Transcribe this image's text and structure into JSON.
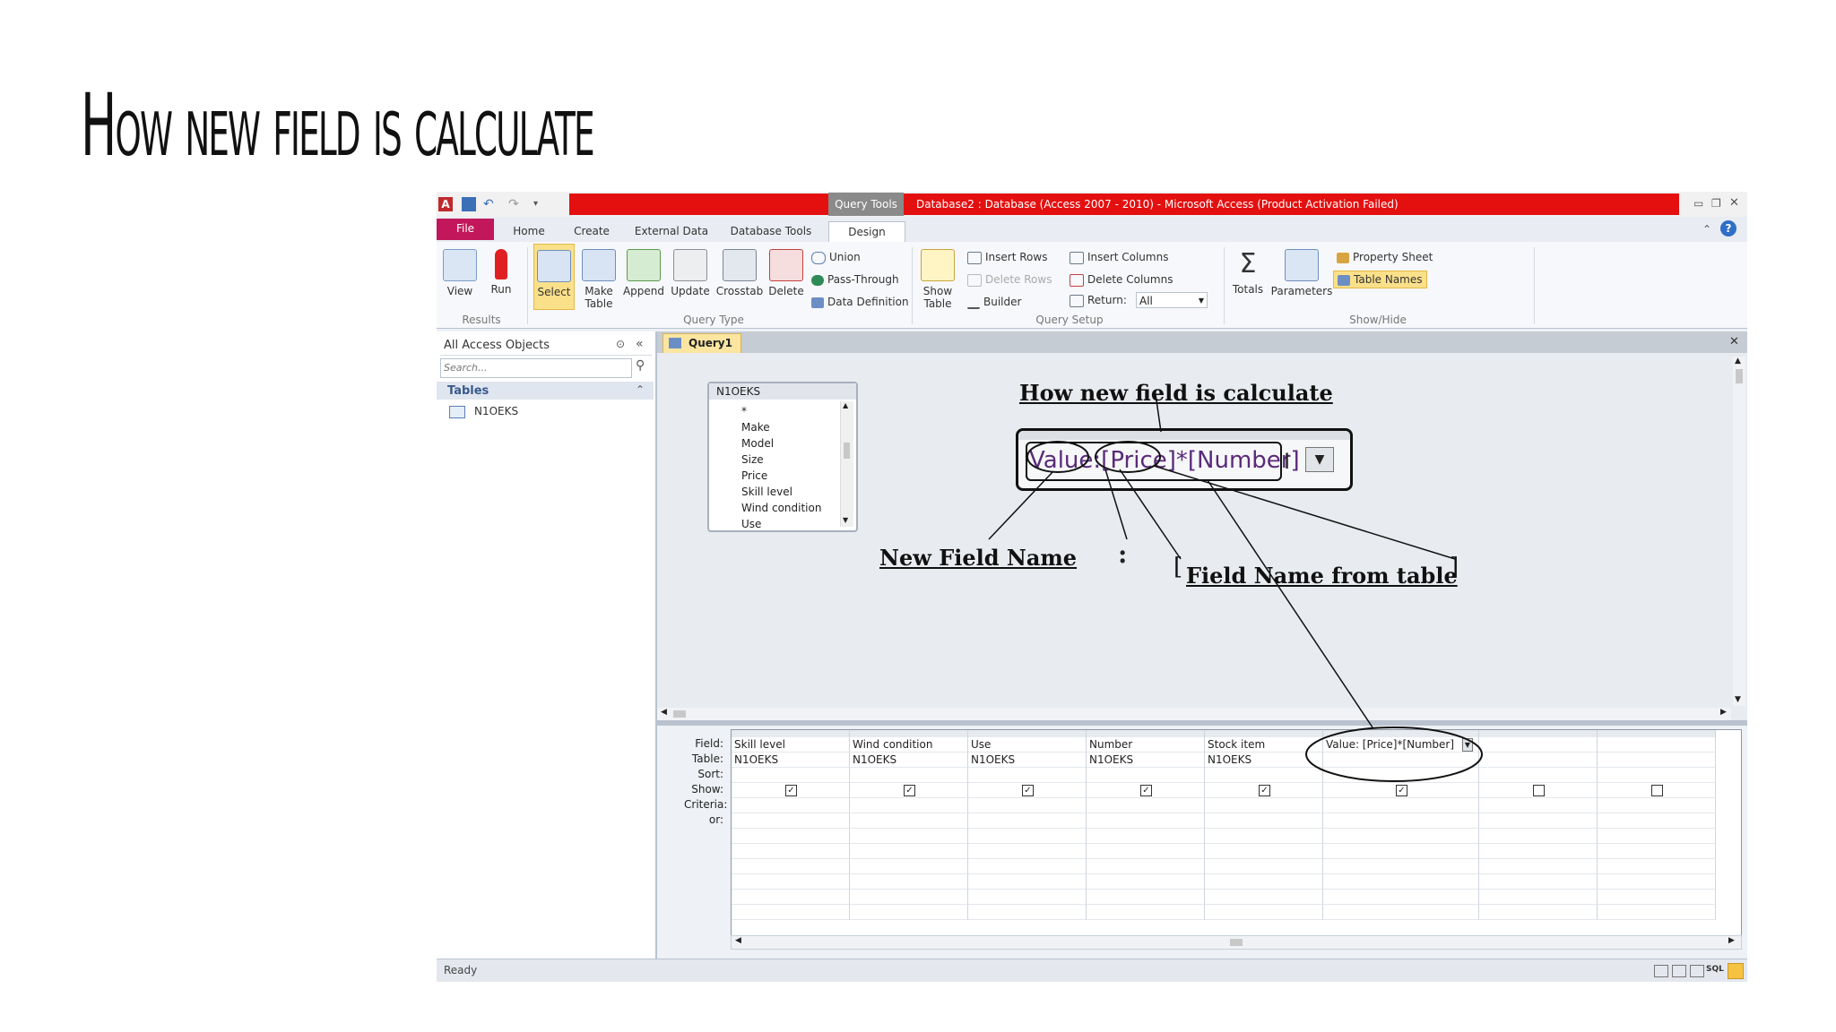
{
  "slide": {
    "title": "How new field is calculate"
  },
  "window": {
    "title": "Database2 : Database (Access 2007 - 2010) - Microsoft Access (Product Activation Failed)",
    "context_tab": "Query Tools"
  },
  "tabs": {
    "file": "File",
    "home": "Home",
    "create": "Create",
    "external": "External Data",
    "dbtools": "Database Tools",
    "design": "Design"
  },
  "ribbon": {
    "view": "View",
    "run": "Run",
    "select": "Select",
    "make1": "Make",
    "make2": "Table",
    "append": "Append",
    "update": "Update",
    "crosstab": "Crosstab",
    "delete": "Delete",
    "union": "Union",
    "passthrough": "Pass-Through",
    "datadef": "Data Definition",
    "show1": "Show",
    "show2": "Table",
    "insert_rows": "Insert Rows",
    "delete_rows": "Delete Rows",
    "builder": "Builder",
    "insert_cols": "Insert Columns",
    "delete_cols": "Delete Columns",
    "return_label": "Return:",
    "return_value": "All",
    "totals": "Totals",
    "parameters": "Parameters",
    "property_sheet": "Property Sheet",
    "table_names": "Table Names",
    "g_results": "Results",
    "g_query_type": "Query Type",
    "g_query_setup": "Query Setup",
    "g_show_hide": "Show/Hide"
  },
  "nav": {
    "header": "All Access Objects",
    "search_placeholder": "Search...",
    "section": "Tables",
    "table": "N1OEKS"
  },
  "query": {
    "tab": "Query1",
    "table_box": {
      "name": "N1OEKS",
      "fields": [
        "*",
        "Make",
        "Model",
        "Size",
        "Price",
        "Skill level",
        "Wind condition",
        "Use"
      ]
    }
  },
  "grid": {
    "row_labels": [
      "Field:",
      "Table:",
      "Sort:",
      "Show:",
      "Criteria:",
      "or:"
    ],
    "columns": [
      {
        "field": "Skill level",
        "table": "N1OEKS",
        "show": true
      },
      {
        "field": "Wind condition",
        "table": "N1OEKS",
        "show": true
      },
      {
        "field": "Use",
        "table": "N1OEKS",
        "show": true
      },
      {
        "field": "Number",
        "table": "N1OEKS",
        "show": true
      },
      {
        "field": "Stock item",
        "table": "N1OEKS",
        "show": true
      },
      {
        "field": "Value: [Price]*[Number]",
        "table": "",
        "show": true
      },
      {
        "field": "",
        "table": "",
        "show": false
      },
      {
        "field": "",
        "table": "",
        "show": false
      }
    ]
  },
  "annotations": {
    "title": "How new field is calculate",
    "expr_name": "Value",
    "expr_colon": ":",
    "expr_field1": "[Price]",
    "expr_op": "*",
    "expr_field2": "[Number]",
    "new_field_name": "New Field Name",
    "colon_label": ":",
    "field_from_table": "Field Name from table"
  },
  "status": {
    "text": "Ready"
  },
  "colors": {
    "accent_red": "#e41010",
    "file_tab": "#c2185b",
    "select_highlight": "#fbe08a"
  }
}
